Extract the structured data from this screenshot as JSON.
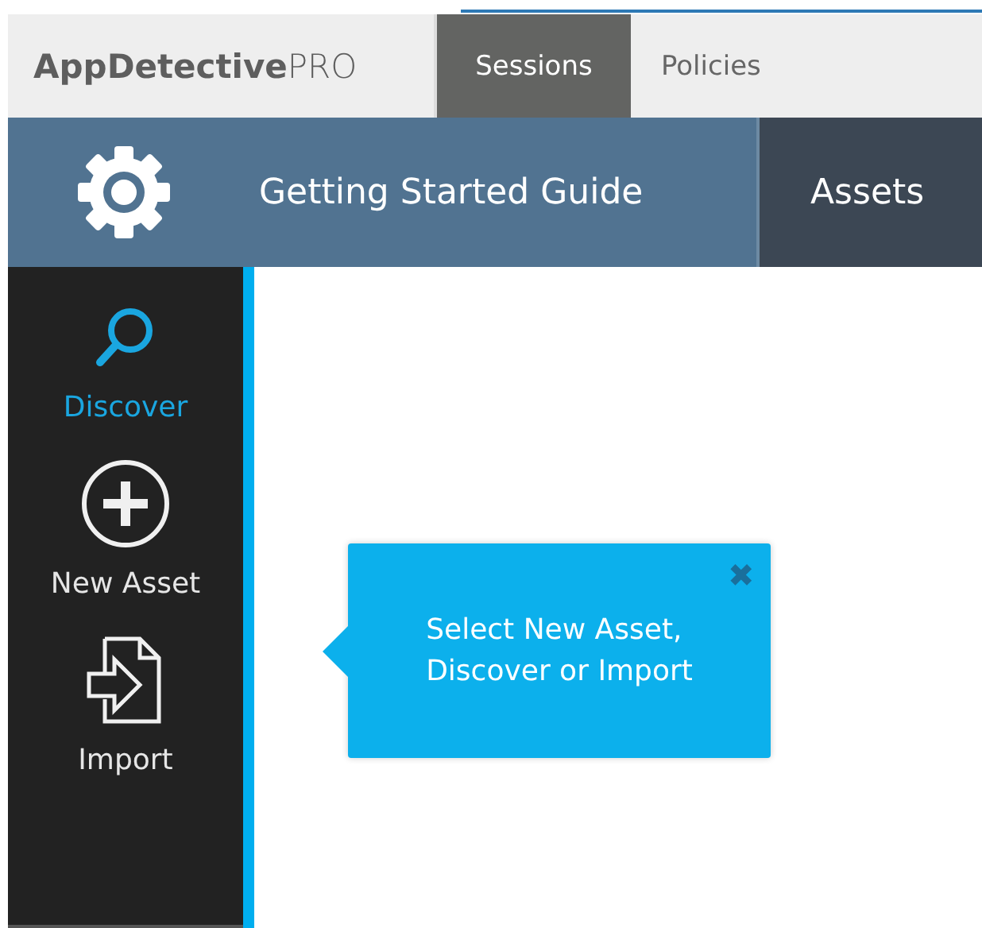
{
  "logo": "**AppDetective**PRO",
  "tabs": [
    {
      "label": "Sessions",
      "selected": true
    },
    {
      "label": "Policies",
      "selected": false
    }
  ],
  "nav": [
    {
      "label": "Getting Started Guide",
      "selected": true
    },
    {
      "label": "Assets",
      "selected": false
    }
  ],
  "sidebar": {
    "items": [
      {
        "label": "Discover",
        "kind": "search",
        "selected": true
      },
      {
        "label": "New Asset",
        "kind": "add",
        "selected": false
      },
      {
        "label": "Import",
        "kind": "import",
        "selected": false
      }
    ]
  },
  "popover": {
    "text": "Select New Asset,\nDiscover or Import",
    "close": "✖"
  }
}
